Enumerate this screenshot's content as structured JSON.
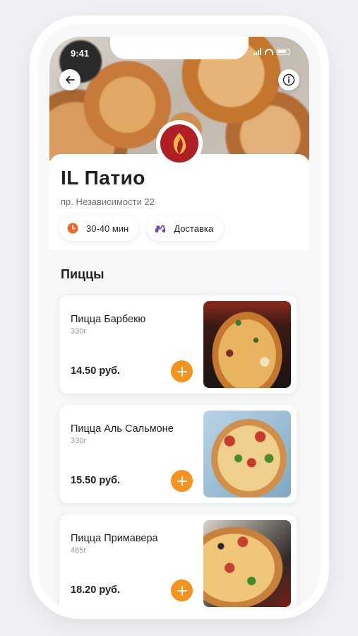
{
  "status_bar": {
    "time": "9:41"
  },
  "restaurant": {
    "name": "IL Патио",
    "address": "пр. Независимости 22",
    "delivery_time": "30-40 мин",
    "delivery_label": "Доставка"
  },
  "section": {
    "title": "Пиццы"
  },
  "products": [
    {
      "name": "Пицца Барбекю",
      "weight": "330г",
      "price": "14.50 руб."
    },
    {
      "name": "Пицца Аль Сальмоне",
      "weight": "330г",
      "price": "15.50 руб."
    },
    {
      "name": "Пицца Примавера",
      "weight": "485г",
      "price": "18.20 руб."
    }
  ],
  "icons": {
    "back": "arrow-left-icon",
    "info": "info-icon",
    "logo": "flame-logo",
    "time": "clock-icon",
    "delivery": "scooter-icon",
    "add": "plus-icon"
  },
  "colors": {
    "accent": "#f39320",
    "logo_red": "#b01f24",
    "delivery_icon": "#6a3fb5",
    "clock_icon": "#ee6a2a"
  }
}
